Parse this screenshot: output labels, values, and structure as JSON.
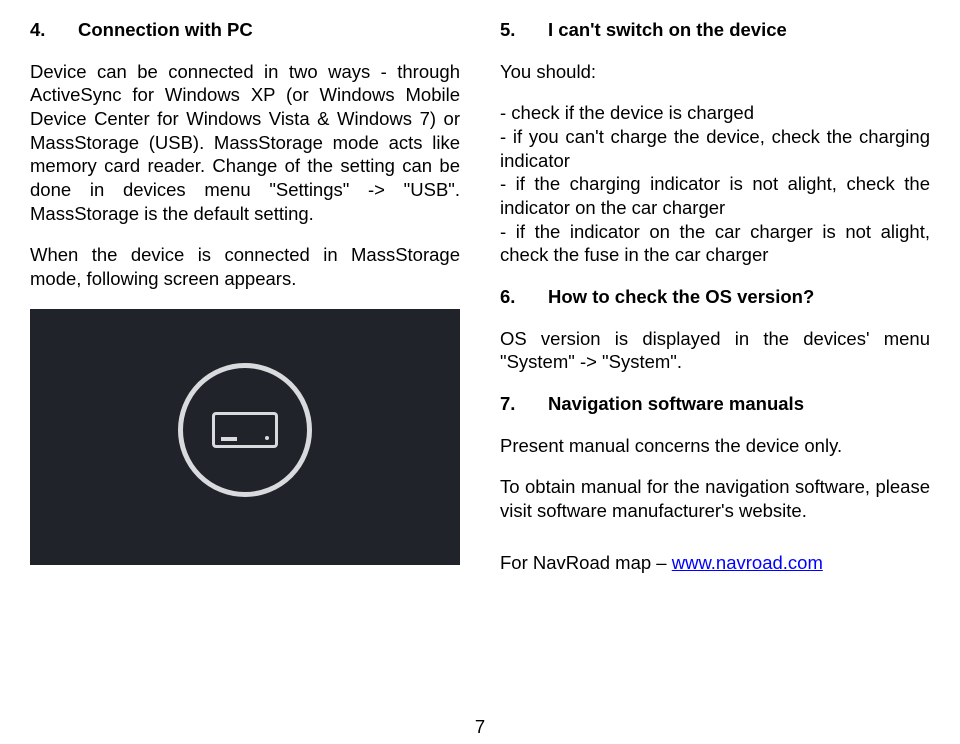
{
  "page_number": "7",
  "left": {
    "h4_num": "4.",
    "h4_title": "Connection with PC",
    "p1": "Device can be connected in two ways - through ActiveSync for Windows XP (or Windows Mobile Device Center for Windows Vista & Windows 7) or MassStorage (USB). MassStorage mode acts like memory card reader. Change of the setting can be done in devices menu \"Settings\" -> \"USB\". MassStorage is the default setting.",
    "p2": "When the device is connected in MassStorage mode, following screen appears."
  },
  "right": {
    "h5_num": "5.",
    "h5_title": "I can't switch on the device",
    "p1": "You should:",
    "p2": "- check if the device is charged\n- if you can't charge the device, check the charging indicator\n- if the charging indicator is not alight, check the indicator on the car charger\n- if the indicator on the car charger is not alight, check the fuse in the car charger",
    "h6_num": "6.",
    "h6_title": "How to check the OS version?",
    "p3": "OS version is displayed in the devices' menu \"System\" -> \"System\".",
    "h7_num": "7.",
    "h7_title": "Navigation software manuals",
    "p4": "Present manual concerns the device only.",
    "p5": "To obtain manual for the navigation software, please visit software manufacturer's website.",
    "p6_prefix": "For NavRoad map – ",
    "link_text": "www.navroad.com"
  }
}
